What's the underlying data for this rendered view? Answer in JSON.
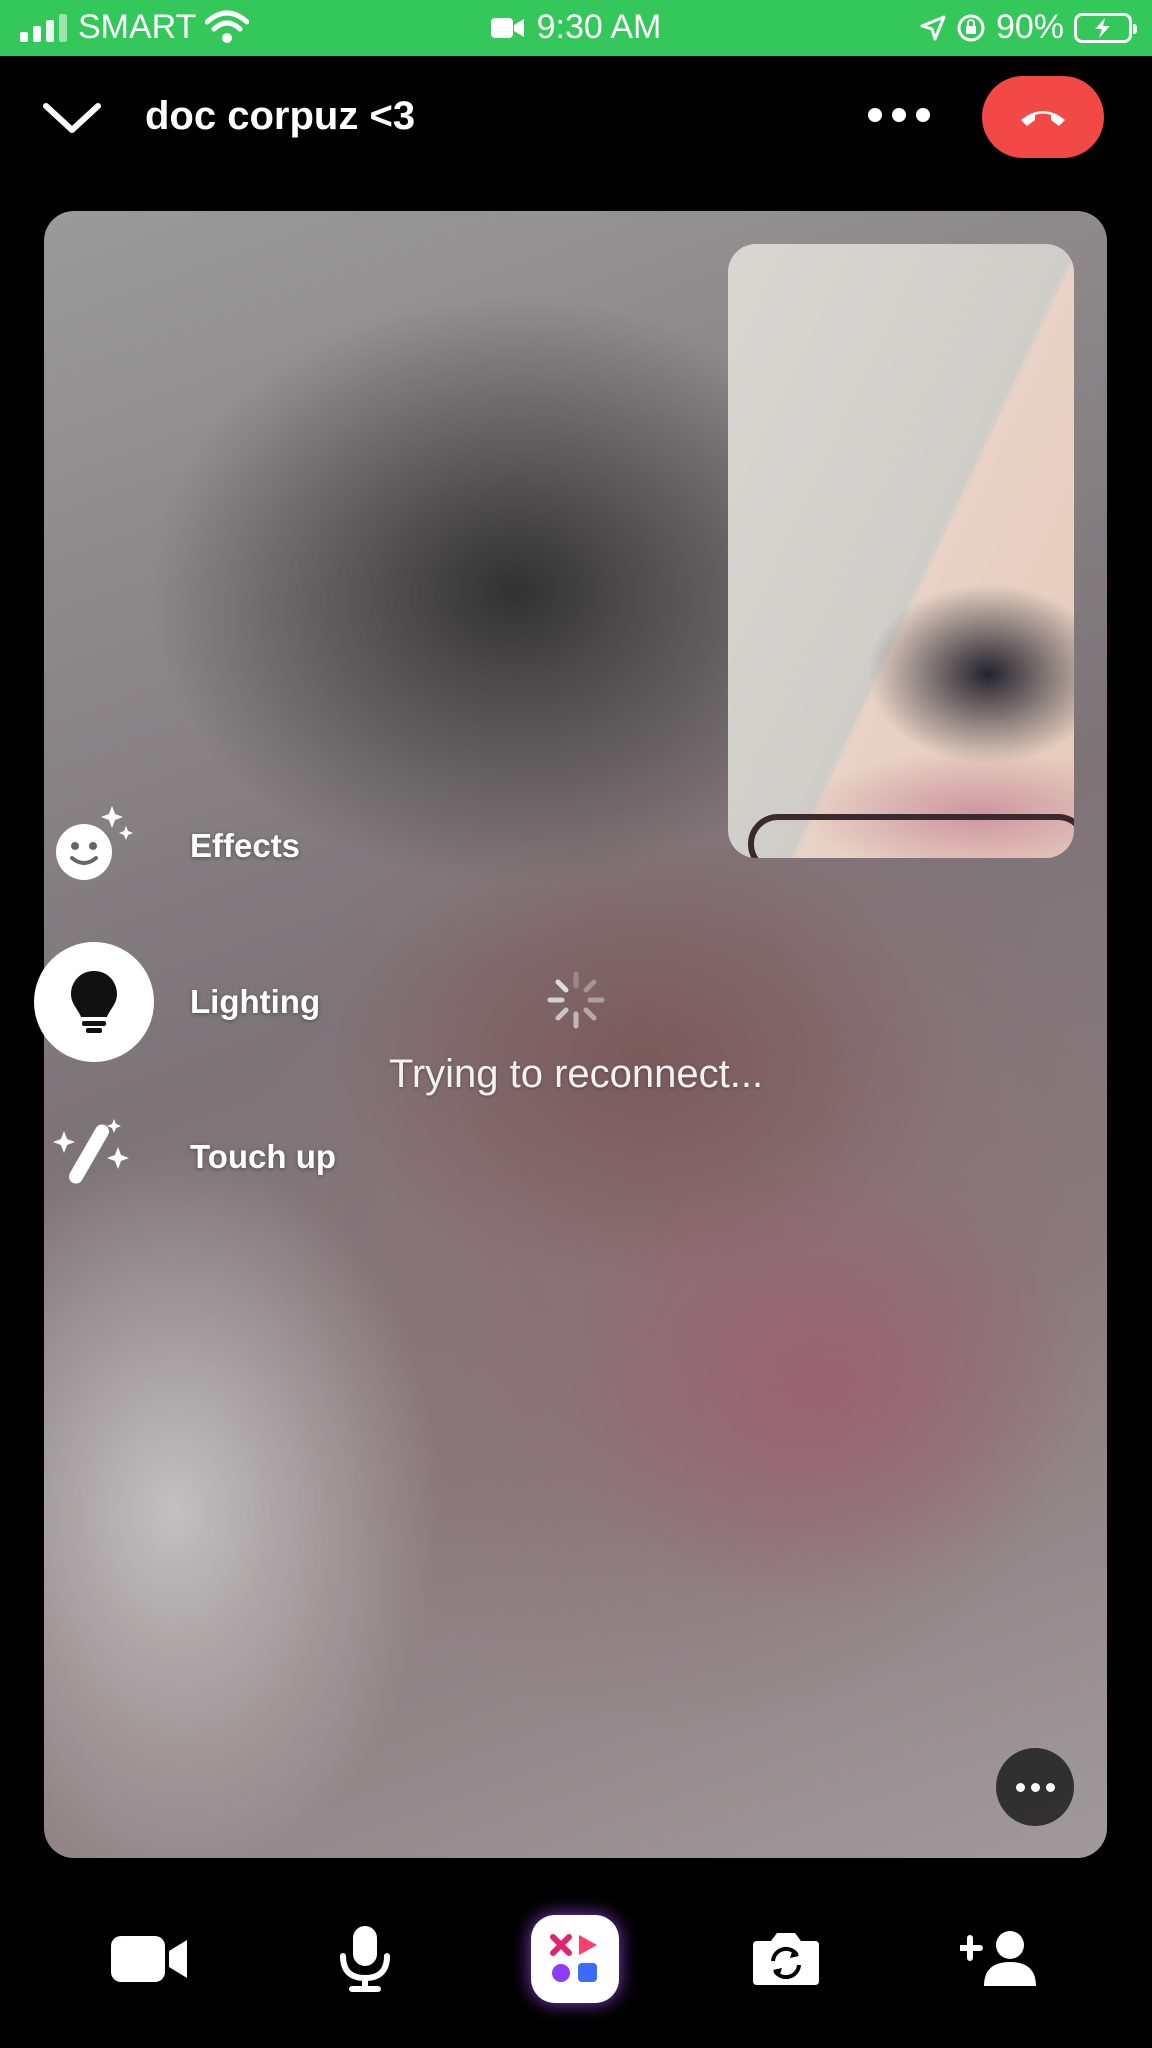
{
  "status_bar": {
    "carrier": "SMART",
    "time": "9:30 AM",
    "battery": "90%"
  },
  "header": {
    "title": "doc corpuz <3"
  },
  "side_menu": {
    "effects": "Effects",
    "lighting": "Lighting",
    "touch_up": "Touch up"
  },
  "call": {
    "status_text": "Trying to reconnect..."
  },
  "colors": {
    "status_bar": "#34c759",
    "end_call": "#f24846",
    "background": "#000000"
  },
  "bottom_controls": [
    "video-camera-icon",
    "microphone-icon",
    "apps-icon",
    "flip-camera-icon",
    "add-person-icon"
  ]
}
